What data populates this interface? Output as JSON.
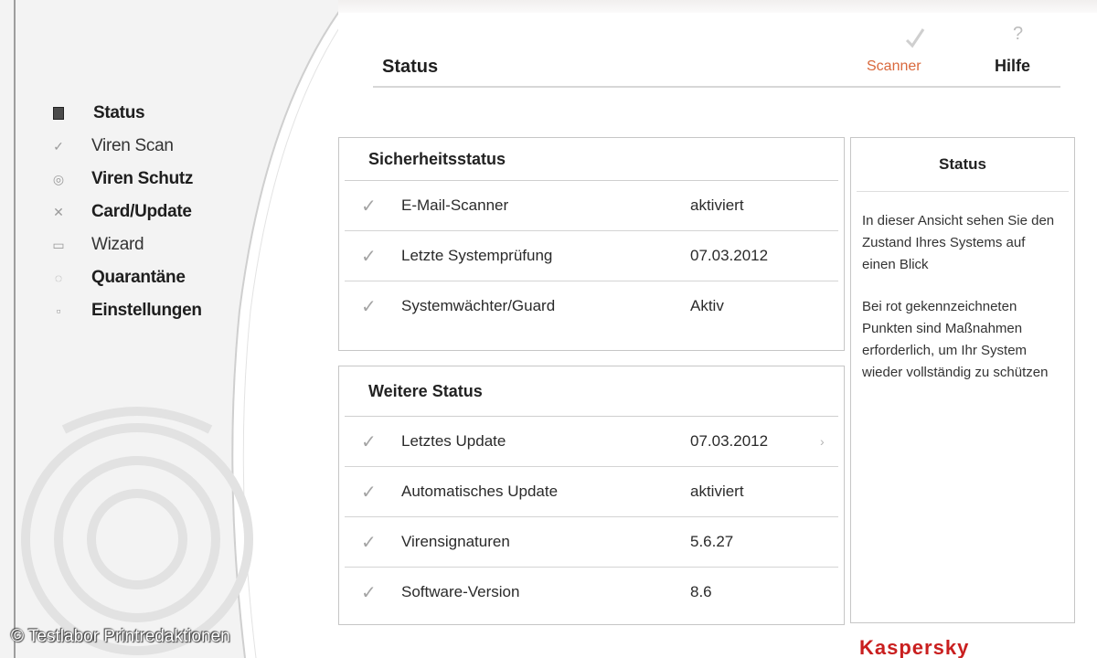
{
  "header": {
    "title": "Status",
    "link_label": "Scanner",
    "help_label": "Hilfe"
  },
  "sidebar": {
    "items": [
      {
        "label": "Status",
        "icon": "square-bullet-icon"
      },
      {
        "label": "Viren Scan",
        "icon": "check-icon"
      },
      {
        "label": "Viren Schutz",
        "icon": "shield-icon"
      },
      {
        "label": "Card/Update",
        "icon": "update-icon"
      },
      {
        "label": "Wizard",
        "icon": "wizard-icon"
      },
      {
        "label": "Quarantäne",
        "icon": "quarantine-icon"
      },
      {
        "label": "Einstellungen",
        "icon": "settings-icon"
      }
    ]
  },
  "security_status": {
    "heading": "Sicherheitsstatus",
    "rows": [
      {
        "label": "E-Mail-Scanner",
        "value": "aktiviert"
      },
      {
        "label": "Letzte Systemprüfung",
        "value": "07.03.2012"
      },
      {
        "label": "Systemwächter/Guard",
        "value": "Aktiv"
      }
    ]
  },
  "update_status": {
    "heading": "Weitere Status",
    "rows": [
      {
        "label": "Letztes Update",
        "value": "07.03.2012"
      },
      {
        "label": "Automatisches Update",
        "value": "aktiviert"
      },
      {
        "label": "Virensignaturen",
        "value": "5.6.27"
      },
      {
        "label": "Software-Version",
        "value": "8.6"
      }
    ]
  },
  "side_panel": {
    "heading": "Status",
    "paragraph1": "In dieser Ansicht sehen Sie den Zustand Ihres Systems auf einen Blick",
    "paragraph2": "Bei rot gekennzeichneten Punkten sind Maßnahmen erforderlich, um Ihr System wieder vollständig zu schützen"
  },
  "watermark": "© Testlabor Printredaktionen",
  "brand": "Kaspersky"
}
